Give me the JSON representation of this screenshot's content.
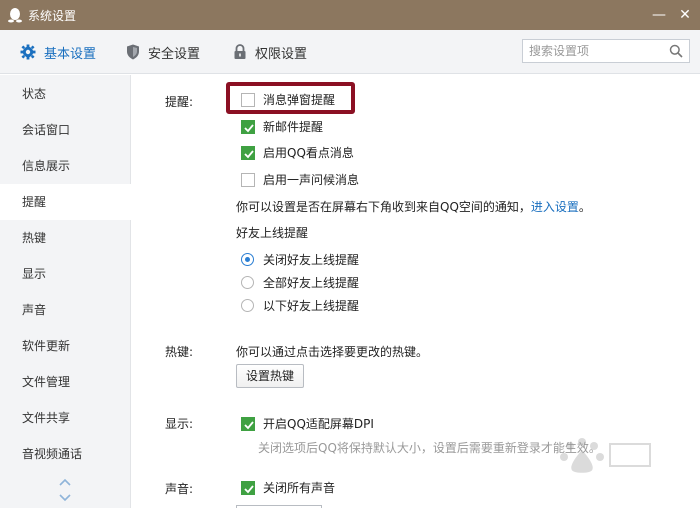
{
  "window": {
    "title": "系统设置"
  },
  "toolbar": {
    "tabs": [
      {
        "label": "基本设置",
        "icon": "gear-icon",
        "active": true
      },
      {
        "label": "安全设置",
        "icon": "shield-icon",
        "active": false
      },
      {
        "label": "权限设置",
        "icon": "lock-icon",
        "active": false
      }
    ],
    "search_placeholder": "搜索设置项"
  },
  "sidebar": {
    "items": [
      {
        "label": "状态"
      },
      {
        "label": "会话窗口"
      },
      {
        "label": "信息展示"
      },
      {
        "label": "提醒",
        "active": true
      },
      {
        "label": "热键"
      },
      {
        "label": "显示"
      },
      {
        "label": "声音"
      },
      {
        "label": "软件更新"
      },
      {
        "label": "文件管理"
      },
      {
        "label": "文件共享"
      },
      {
        "label": "音视频通话"
      }
    ]
  },
  "reminders": {
    "label": "提醒:",
    "options": [
      {
        "label": "消息弹窗提醒",
        "checked": false
      },
      {
        "label": "新邮件提醒",
        "checked": true
      },
      {
        "label": "启用QQ看点消息",
        "checked": true
      },
      {
        "label": "启用一声问候消息",
        "checked": false
      }
    ],
    "notice_text": "你可以设置是否在屏幕右下角收到来自QQ空间的通知，",
    "notice_link": "进入设置",
    "notice_end": "。",
    "friend_online_title": "好友上线提醒",
    "friend_online_options": [
      {
        "label": "关闭好友上线提醒",
        "selected": true
      },
      {
        "label": "全部好友上线提醒",
        "selected": false
      },
      {
        "label": "以下好友上线提醒",
        "selected": false
      }
    ]
  },
  "hotkeys": {
    "label": "热键:",
    "description": "你可以通过点击选择要更改的热键。",
    "button_label": "设置热键"
  },
  "display": {
    "label": "显示:",
    "option_label": "开启QQ适配屏幕DPI",
    "option_checked": true,
    "hint": "关闭选项后QQ将保持默认大小，设置后需要重新登录才能生效。"
  },
  "sound": {
    "label": "声音:",
    "option_label": "关闭所有声音",
    "option_checked": true
  },
  "colors": {
    "titlebar": "#8c775f",
    "accent": "#1a6fbf",
    "checkbox_green": "#3fa142",
    "highlight_border": "#8b1023"
  }
}
